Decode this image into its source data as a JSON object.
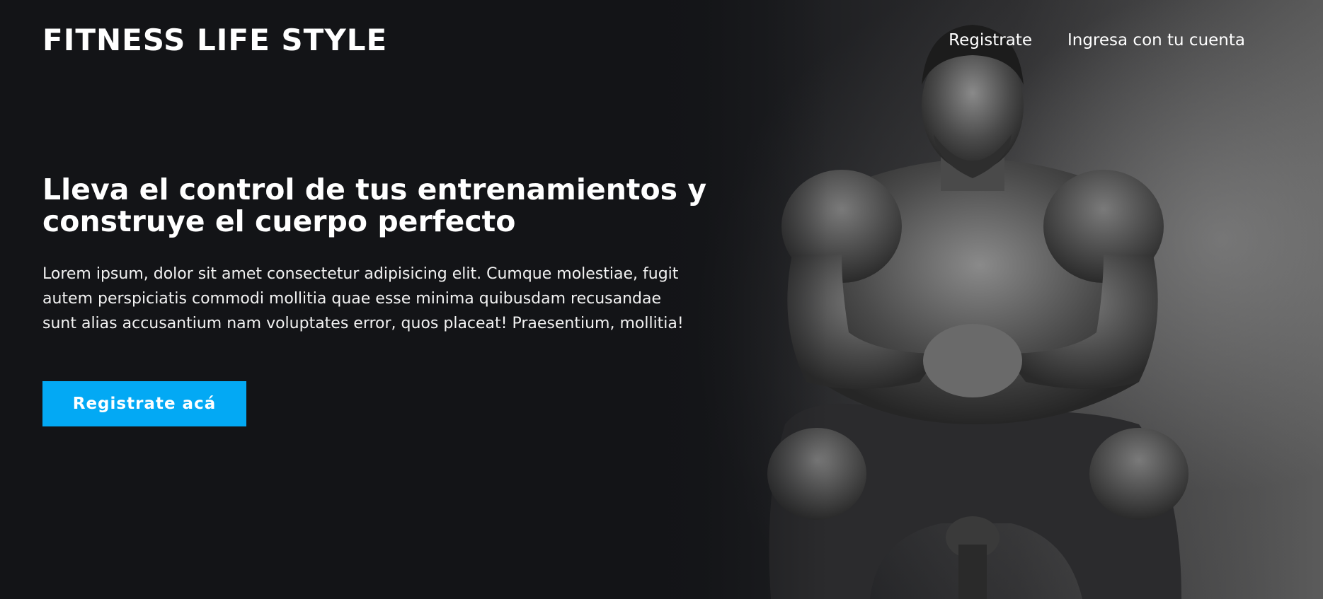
{
  "header": {
    "brand": "FITNESS LIFE STYLE",
    "nav": [
      {
        "label": "Registrate"
      },
      {
        "label": "Ingresa con tu cuenta"
      }
    ]
  },
  "hero": {
    "title": "Lleva el control de tus entrenamientos y construye el cuerpo perfecto",
    "description": "Lorem ipsum, dolor sit amet consectetur adipisicing elit. Cumque molestiae, fugit autem perspiciatis commodi mollitia quae esse minima quibusdam recusandae sunt alias accusantium nam voluptates error, quos placeat! Praesentium, mollitia!",
    "cta_label": "Registrate acá",
    "image": "athlete-photo"
  },
  "colors": {
    "background": "#131417",
    "accent": "#03a9f4",
    "text": "#ffffff"
  }
}
